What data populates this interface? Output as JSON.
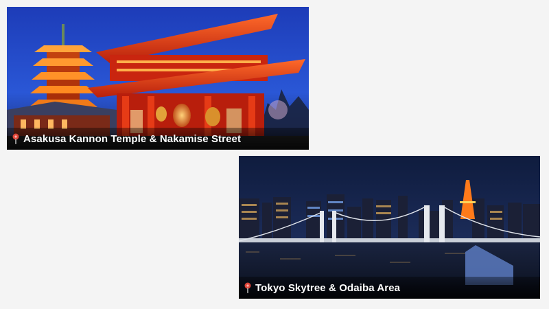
{
  "cards": [
    {
      "title": "Asakusa Kannon Temple & Nakamise Street",
      "pin_icon": "map-pin-icon",
      "scene": "night-temple-gate-and-pagoda"
    },
    {
      "title": "Tokyo Skytree & Odaiba Area",
      "pin_icon": "map-pin-icon",
      "scene": "night-city-skyline-with-bridge"
    }
  ],
  "colors": {
    "page_background": "#f4f4f4",
    "pin": "#e0463a",
    "caption_text": "#ffffff"
  }
}
